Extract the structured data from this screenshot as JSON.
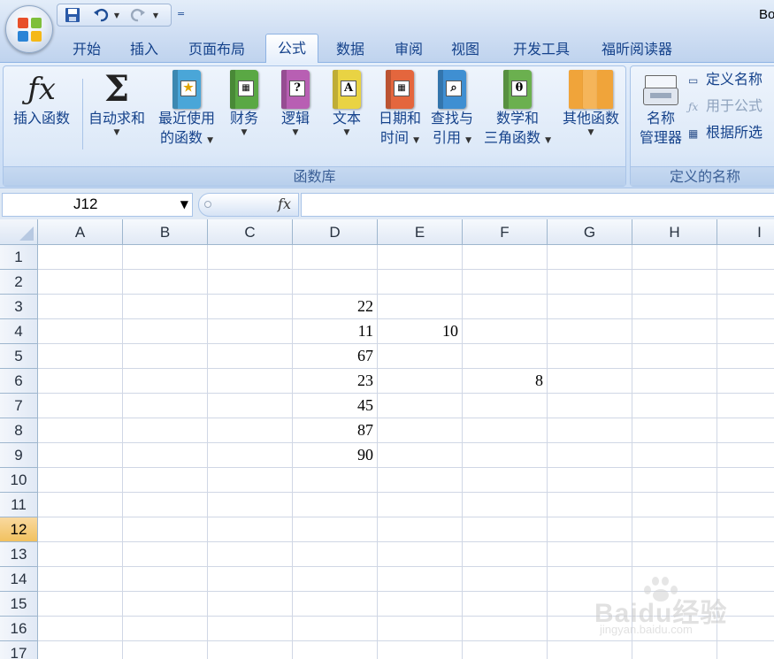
{
  "window": {
    "doc_title": "Bo"
  },
  "qat": {
    "save_icon": "save-icon",
    "undo_icon": "undo-icon",
    "redo_icon": "redo-icon",
    "customize": "="
  },
  "tabs": [
    {
      "label": "开始"
    },
    {
      "label": "插入"
    },
    {
      "label": "页面布局"
    },
    {
      "label": "公式",
      "active": true
    },
    {
      "label": "数据"
    },
    {
      "label": "审阅"
    },
    {
      "label": "视图"
    },
    {
      "label": "开发工具"
    },
    {
      "label": "福昕阅读器"
    }
  ],
  "ribbon": {
    "function_library": {
      "label": "函数库",
      "insert_function": "插入函数",
      "autosum": "自动求和",
      "recent_1": "最近使用",
      "recent_2": "的函数",
      "financial": "财务",
      "logical": "逻辑",
      "text": "文本",
      "datetime_1": "日期和",
      "datetime_2": "时间",
      "lookup_1": "查找与",
      "lookup_2": "引用",
      "math_1": "数学和",
      "math_2": "三角函数",
      "more": "其他函数"
    },
    "defined_names": {
      "label": "定义的名称",
      "name_manager_1": "名称",
      "name_manager_2": "管理器",
      "define_name": "定义名称",
      "use_in_formula": "用于公式",
      "create_from_selection": "根据所选"
    }
  },
  "formula_bar": {
    "name_box": "J12",
    "fx_label": "fx",
    "formula": ""
  },
  "sheet": {
    "columns": [
      "A",
      "B",
      "C",
      "D",
      "E",
      "F",
      "G",
      "H",
      "I"
    ],
    "rows": [
      "1",
      "2",
      "3",
      "4",
      "5",
      "6",
      "7",
      "8",
      "9",
      "10",
      "11",
      "12",
      "13",
      "14",
      "15",
      "16",
      "17"
    ],
    "selected_row": "12",
    "cells": {
      "D3": "22",
      "D4": "11",
      "E4": "10",
      "D5": "67",
      "D6": "23",
      "F6": "8",
      "D7": "45",
      "D8": "87",
      "D9": "90"
    }
  },
  "watermark": {
    "brand": "Baidu经验",
    "url": "jingyan.baidu.com"
  },
  "colors": {
    "ribbon_text": "#15428b",
    "selected_row_header": "#f1c15f"
  }
}
